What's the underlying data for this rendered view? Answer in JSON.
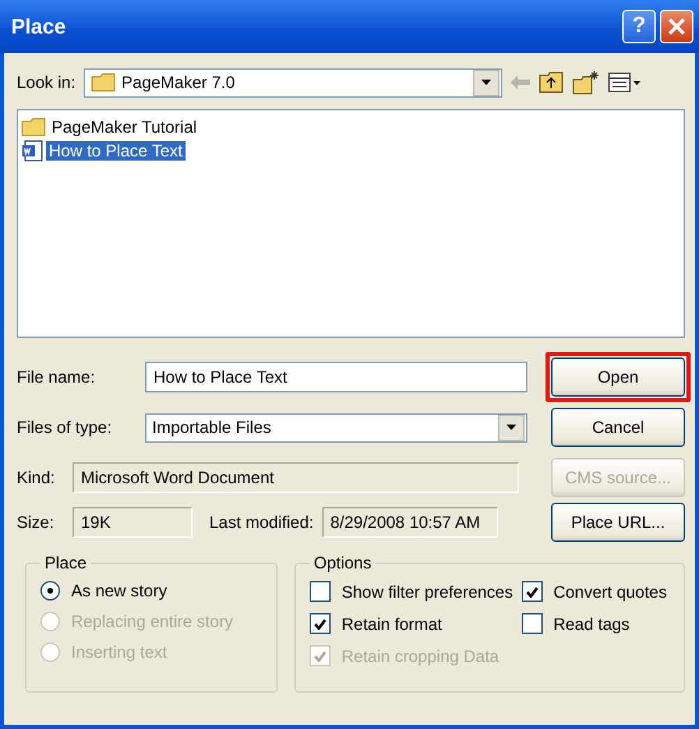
{
  "window": {
    "title": "Place",
    "help": "?"
  },
  "look_in": {
    "label": "Look in:",
    "value": "PageMaker 7.0"
  },
  "files": [
    {
      "name": "PageMaker Tutorial",
      "kind": "folder",
      "selected": false
    },
    {
      "name": "How to Place Text",
      "kind": "document",
      "selected": true
    }
  ],
  "file_name": {
    "label": "File name:",
    "value": "How to Place Text"
  },
  "files_of_type": {
    "label": "Files of type:",
    "value": "Importable Files"
  },
  "buttons": [
    {
      "label": "Open",
      "disabled": false,
      "highlighted": true
    },
    {
      "label": "Cancel",
      "disabled": false,
      "highlighted": false
    },
    {
      "label": "CMS source...",
      "disabled": true,
      "highlighted": false
    },
    {
      "label": "Place URL...",
      "disabled": false,
      "highlighted": false
    }
  ],
  "kind": {
    "label": "Kind:",
    "value": "Microsoft Word Document"
  },
  "size": {
    "label": "Size:",
    "value": "19K"
  },
  "last_modified": {
    "label": "Last modified:",
    "value": "8/29/2008 10:57 AM"
  },
  "place_group": {
    "title": "Place",
    "options": [
      {
        "label": "As new story",
        "selected": true,
        "disabled": false
      },
      {
        "label": "Replacing entire story",
        "selected": false,
        "disabled": true
      },
      {
        "label": "Inserting text",
        "selected": false,
        "disabled": true
      }
    ]
  },
  "options_group": {
    "title": "Options",
    "checkboxes": [
      {
        "label": "Show filter preferences",
        "checked": false,
        "disabled": false
      },
      {
        "label": "Convert quotes",
        "checked": true,
        "disabled": false
      },
      {
        "label": "Retain format",
        "checked": true,
        "disabled": false
      },
      {
        "label": "Read tags",
        "checked": false,
        "disabled": false
      },
      {
        "label": "Retain cropping Data",
        "checked": true,
        "disabled": true
      }
    ]
  }
}
